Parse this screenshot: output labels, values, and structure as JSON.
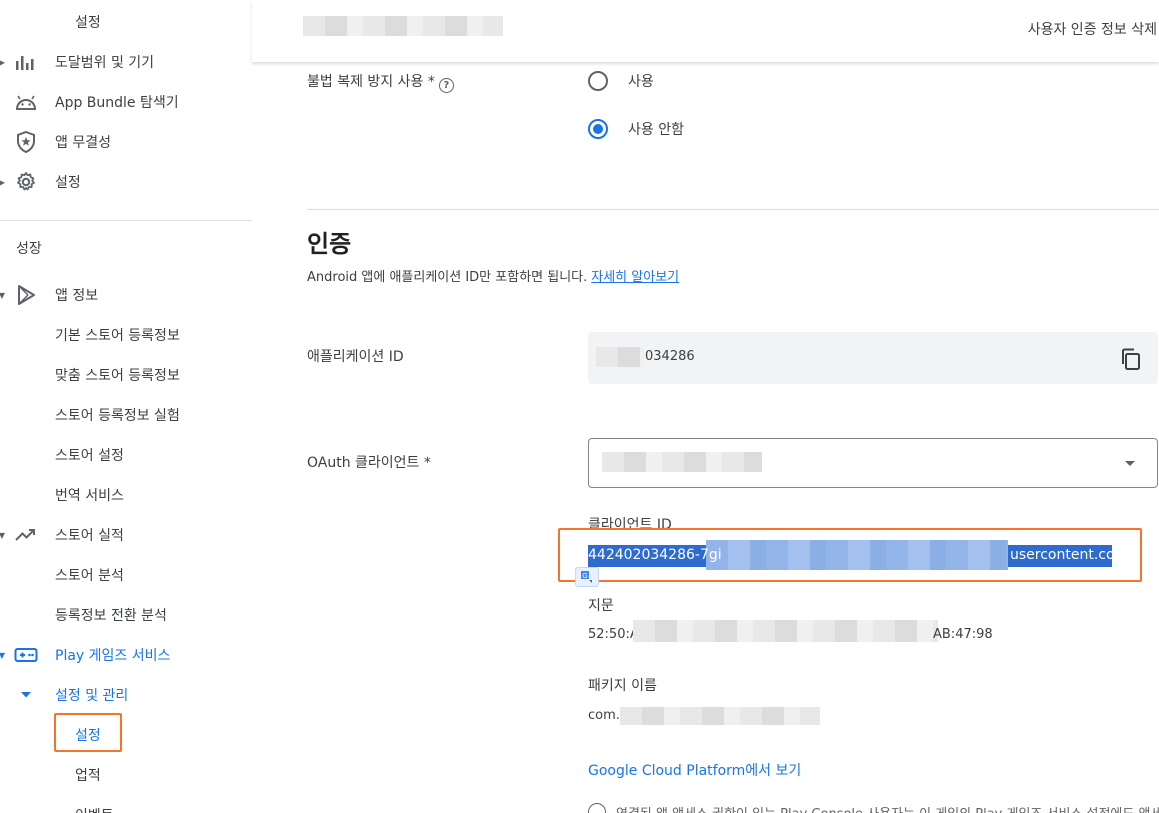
{
  "sidebar": {
    "top_sub_item": "설정",
    "items_top": [
      {
        "label": "도달범위 및 기기",
        "icon": "bar-chart-icon"
      },
      {
        "label": "App Bundle 탐색기",
        "icon": "android-icon"
      },
      {
        "label": "앱 무결성",
        "icon": "shield-star-icon"
      },
      {
        "label": "설정",
        "icon": "gear-icon"
      }
    ],
    "section_heading": "성장",
    "app_info": {
      "label": "앱 정보",
      "icon": "play-icon"
    },
    "app_info_sub": [
      "기본 스토어 등록정보",
      "맞춤 스토어 등록정보",
      "스토어 등록정보 실험",
      "스토어 설정",
      "번역 서비스"
    ],
    "store_perf": {
      "label": "스토어 실적",
      "icon": "trending-up-icon"
    },
    "store_perf_sub": [
      "스토어 분석",
      "등록정보 전환 분석"
    ],
    "play_games": {
      "label": "Play 게임즈 서비스",
      "icon": "gamepad-icon"
    },
    "setup_manage": "설정 및 관리",
    "setup_manage_sub": [
      "설정",
      "업적",
      "이벤트"
    ],
    "active_color": "#1a73e8",
    "highlight_color": "#f4742a"
  },
  "header": {
    "right_action": "사용자 인증 정보 삭제"
  },
  "anti_piracy": {
    "label": "불법 복제 방지 사용 *",
    "help_icon": "help-circle-icon",
    "options": [
      "사용",
      "사용 안함"
    ],
    "selected": "사용 안함"
  },
  "auth": {
    "title": "인증",
    "description": "Android 앱에 애플리케이션 ID만 포함하면 됩니다.",
    "learn_more": "자세히 알아보기",
    "app_id_label": "애플리케이션 ID",
    "app_id_value": "034286",
    "oauth_label": "OAuth 클라이언트  *",
    "client_id_label": "클라이언트 ID",
    "client_id_prefix": "442402034286-7gi",
    "client_id_suffix": "usercontent.com",
    "fingerprint_label": "지문",
    "fingerprint_prefix": "52:50:A",
    "fingerprint_suffix": "AB:47:98",
    "package_label": "패키지 이름",
    "package_prefix": "com.",
    "gcp_link": "Google Cloud Platform에서 보기",
    "info_text": "연결된 앱 액세스 권한이 있는 Play Console 사용자는 이 게임의 Play 게임즈 서비스 설정에도 액세"
  }
}
